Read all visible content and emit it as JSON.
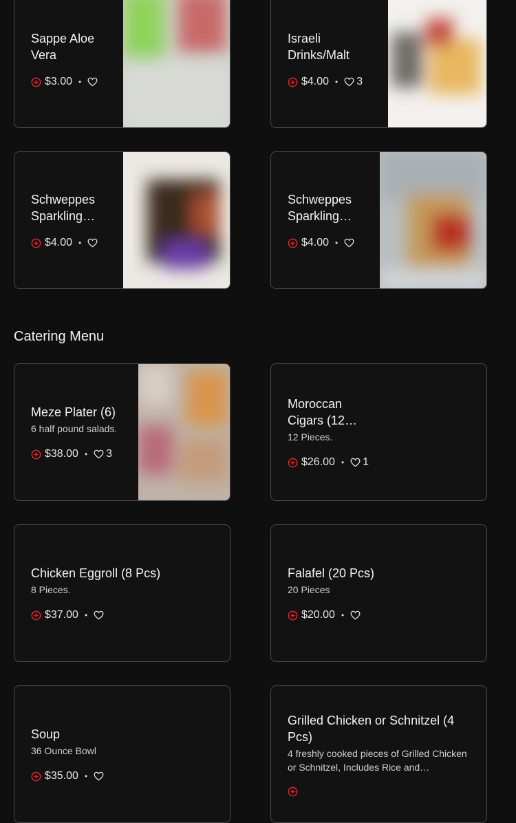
{
  "drinks": {
    "items": [
      {
        "title": "Sappe Aloe Vera",
        "price": "$3.00",
        "likes": ""
      },
      {
        "title": "Israeli Drinks/Malt",
        "price": "$4.00",
        "likes": "3"
      },
      {
        "title": "Schweppes Sparkling…",
        "price": "$4.00",
        "likes": ""
      },
      {
        "title": "Schweppes Sparkling…",
        "price": "$4.00",
        "likes": ""
      }
    ]
  },
  "catering": {
    "heading": "Catering Menu",
    "items": [
      {
        "title": "Meze Plater (6)",
        "desc": "6 half pound salads.",
        "price": "$38.00",
        "likes": "3"
      },
      {
        "title": "Moroccan Cigars (12…",
        "desc": "12 Pieces.",
        "price": "$26.00",
        "likes": "1"
      },
      {
        "title": "Chicken Eggroll (8 Pcs)",
        "desc": "8 Pieces.",
        "price": "$37.00",
        "likes": ""
      },
      {
        "title": "Falafel (20 Pcs)",
        "desc": "20 Pieces",
        "price": "$20.00",
        "likes": ""
      },
      {
        "title": "Soup",
        "desc": "36 Ounce Bowl",
        "price": "$35.00",
        "likes": ""
      },
      {
        "title": "Grilled Chicken or Schnitzel (4 Pcs)",
        "desc": "4 freshly cooked pieces of Grilled Chicken or Schnitzel, Includes Rice and…",
        "price": "",
        "likes": ""
      }
    ]
  },
  "icons": {
    "add": "plus-circle-icon",
    "like": "heart-icon"
  },
  "colors": {
    "background": "#0f0f0f",
    "card_border": "#4a4a4a",
    "accent": "#e0242b"
  }
}
